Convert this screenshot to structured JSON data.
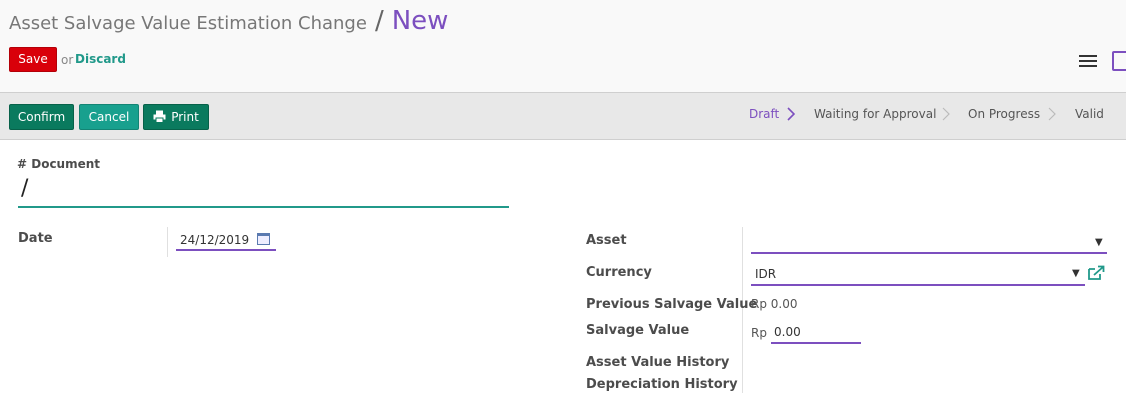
{
  "breadcrumb": {
    "parent": "Asset Salvage Value Estimation Change",
    "separator": "/",
    "current": "New"
  },
  "actions": {
    "save_label": "Save",
    "or_text": "or",
    "discard_label": "Discard"
  },
  "header_buttons": {
    "confirm": "Confirm",
    "cancel": "Cancel",
    "print": "Print"
  },
  "statusbar": {
    "stages": [
      "Draft",
      "Waiting for Approval",
      "On Progress",
      "Valid"
    ],
    "active_stage": "Draft"
  },
  "form": {
    "document_label": "# Document",
    "document_value": "/",
    "date_label": "Date",
    "date_value": "24/12/2019",
    "asset_label": "Asset",
    "asset_value": "",
    "currency_label": "Currency",
    "currency_value": "IDR",
    "previous_salvage_label": "Previous Salvage Value",
    "previous_salvage_value": "Rp 0.00",
    "salvage_label": "Salvage Value",
    "salvage_currency": "Rp",
    "salvage_value": "0.00",
    "asset_history_label": "Asset Value History",
    "depreciation_history_label": "Depreciation History"
  },
  "icons": {
    "menu": "hamburger-menu-icon",
    "view_switch": "form-view-icon",
    "print": "printer-icon",
    "calendar": "calendar-icon",
    "dropdown": "caret-down-icon",
    "external": "external-link-icon"
  },
  "colors": {
    "brand_purple": "#7c4fbf",
    "teal": "#21998a",
    "save_red": "#d9000a",
    "confirm_green": "#0a7a5e",
    "cancel_teal": "#18a08e"
  }
}
